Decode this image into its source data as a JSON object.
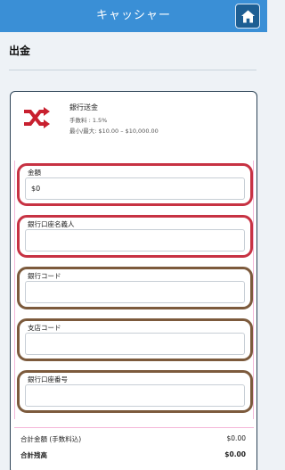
{
  "header": {
    "title": "キャッシャー",
    "home_icon": "home-icon"
  },
  "page": {
    "title": "出金"
  },
  "method": {
    "icon": "shuffle-icon",
    "icon_color": "#c8202f",
    "name": "銀行送金",
    "fee": "手数料 : 1.5%",
    "limits": "最小/最大: $10.00 – $10,000.00"
  },
  "form": {
    "amount": {
      "label": "金額",
      "value": "$0"
    },
    "account_name": {
      "label": "銀行口座名義人",
      "value": ""
    },
    "bank_code": {
      "label": "銀行コード",
      "value": ""
    },
    "branch_code": {
      "label": "支店コード",
      "value": ""
    },
    "account_number": {
      "label": "銀行口座番号",
      "value": ""
    }
  },
  "totals": {
    "total_label": "合計金額 (手数料込)",
    "total_value": "$0.00",
    "balance_label": "合計残高",
    "balance_value": "$0.00"
  },
  "colors": {
    "header": "#3a8fd6",
    "highlight_red": "#c73243",
    "highlight_brown": "#7c5a3c"
  }
}
